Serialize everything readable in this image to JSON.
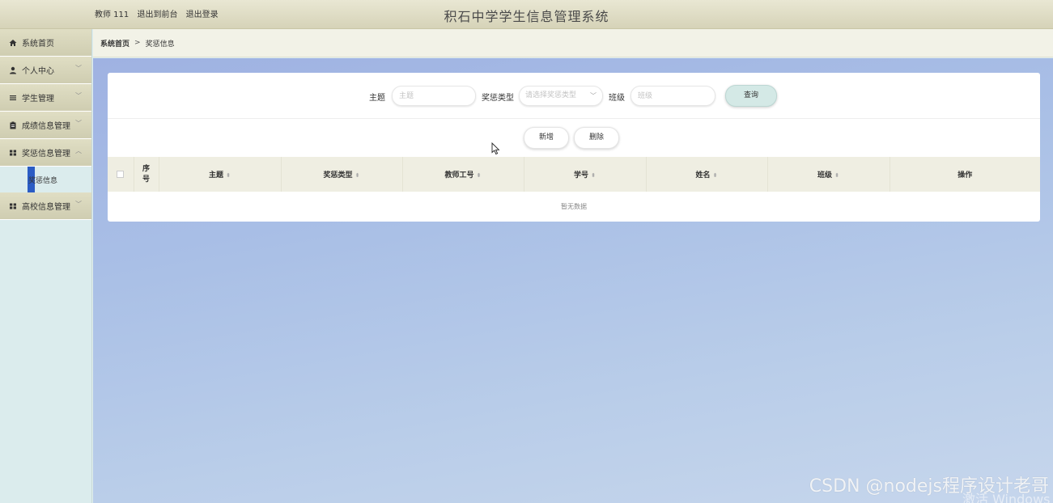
{
  "header": {
    "user_role": "教师 111",
    "exit_front": "退出到前台",
    "logout": "退出登录",
    "title": "积石中学学生信息管理系统"
  },
  "sidebar": {
    "items": [
      {
        "label": "系统首页",
        "icon": "home-icon"
      },
      {
        "label": "个人中心",
        "icon": "user-icon",
        "chevron": "﹀"
      },
      {
        "label": "学生管理",
        "icon": "list-icon",
        "chevron": "﹀"
      },
      {
        "label": "成绩信息管理",
        "icon": "clipboard-icon",
        "chevron": "﹀"
      },
      {
        "label": "奖惩信息管理",
        "icon": "grid-icon",
        "chevron": "︿"
      },
      {
        "label": "高校信息管理",
        "icon": "grid-icon",
        "chevron": "﹀"
      }
    ],
    "sub_item": "奖惩信息"
  },
  "breadcrumb": {
    "home": "系统首页",
    "separator": ">",
    "current": "奖惩信息"
  },
  "search": {
    "subject_label": "主题",
    "subject_placeholder": "主题",
    "type_label": "奖惩类型",
    "type_placeholder": "请选择奖惩类型",
    "class_label": "班级",
    "class_placeholder": "班级",
    "query_button": "查询"
  },
  "actions": {
    "add": "新增",
    "delete": "删除"
  },
  "table": {
    "index_header": "序号",
    "columns": [
      "主题",
      "奖惩类型",
      "教师工号",
      "学号",
      "姓名",
      "班级"
    ],
    "operation": "操作",
    "empty_text": "暂无数据"
  },
  "watermark": {
    "csdn": "CSDN @nodejs程序设计老哥",
    "activate": "激活 Windows"
  },
  "colors": {
    "header_bg": "#dcd9bf",
    "sidebar_bg": "#dbeced",
    "active_marker": "#2b5cc4",
    "query_button_bg": "#d4e9e6"
  }
}
